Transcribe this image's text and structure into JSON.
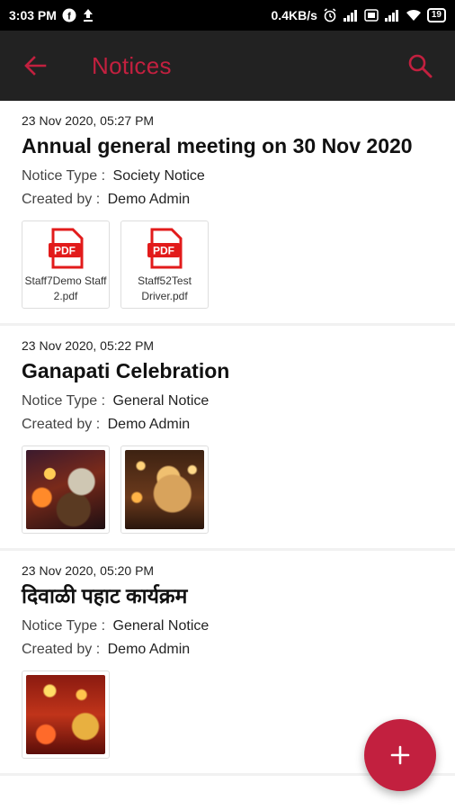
{
  "status_bar": {
    "time": "3:03 PM",
    "net_speed": "0.4KB/s",
    "battery": "19"
  },
  "app_bar": {
    "title": "Notices",
    "title_color": "#c2203f",
    "back_icon": "arrow-left-icon",
    "search_icon": "search-icon"
  },
  "notices": [
    {
      "date": "23 Nov 2020, 05:27 PM",
      "title": "Annual general meeting on 30 Nov 2020",
      "type_label": "Notice Type :",
      "type_value": "Society Notice",
      "created_label": "Created by :",
      "created_value": "Demo  Admin",
      "attachments": [
        {
          "kind": "pdf",
          "badge": "PDF",
          "name": "Staff7Demo Staff 2.pdf"
        },
        {
          "kind": "pdf",
          "badge": "PDF",
          "name": "Staff52Test Driver.pdf"
        }
      ]
    },
    {
      "date": "23 Nov 2020, 05:22 PM",
      "title": "Ganapati Celebration",
      "type_label": "Notice Type :",
      "type_value": "General Notice",
      "created_label": "Created by :",
      "created_value": "Demo  Admin",
      "attachments": [
        {
          "kind": "image",
          "icon": "photo-icon"
        },
        {
          "kind": "image",
          "icon": "photo-icon"
        }
      ]
    },
    {
      "date": "23 Nov 2020, 05:20 PM",
      "title": "दिवाळी पहाट कार्यक्रम",
      "type_label": "Notice Type :",
      "type_value": "General Notice",
      "created_label": "Created by :",
      "created_value": "Demo  Admin",
      "attachments": [
        {
          "kind": "image",
          "icon": "photo-icon"
        }
      ]
    }
  ],
  "fab": {
    "icon": "plus-icon",
    "color": "#c2203f"
  }
}
